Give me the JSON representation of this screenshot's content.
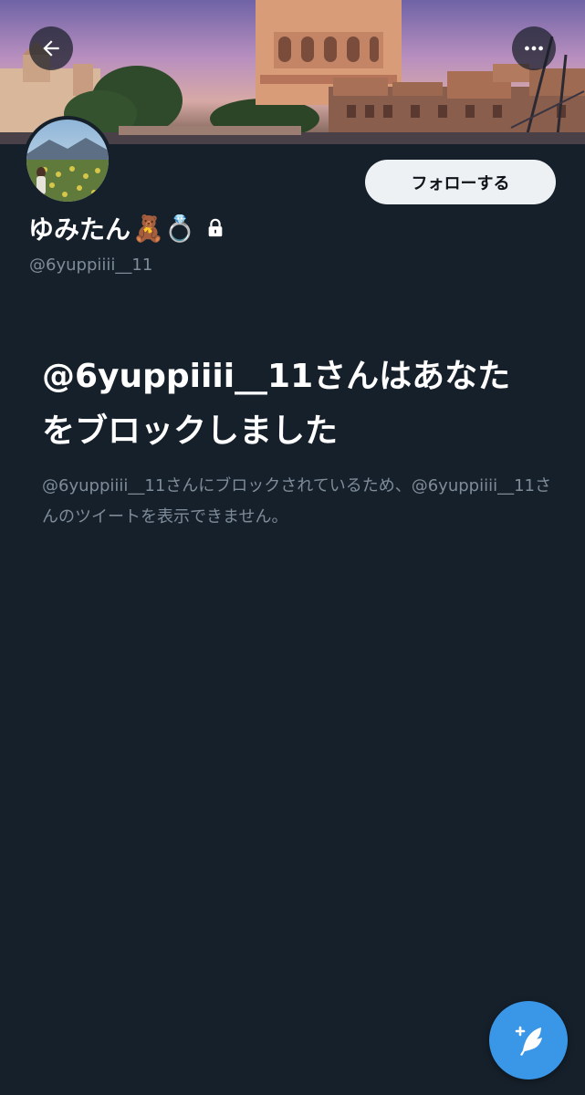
{
  "profile": {
    "display_name": "ゆみたん",
    "name_emojis": "🧸💍",
    "handle": "@6yuppiiii__11",
    "follow_label": "フォローする"
  },
  "blocked": {
    "title": "@6yuppiiii__11さんはあなたをブロックしました",
    "description": "@6yuppiiii__11さんにブロックされているため、@6yuppiiii__11さんのツイートを表示できません。"
  },
  "icons": {
    "back": "arrow-left-icon",
    "more": "more-horizontal-icon",
    "lock": "lock-icon",
    "compose": "compose-tweet-icon"
  },
  "colors": {
    "background": "#16202b",
    "accent": "#3a97e8",
    "secondary_text": "#7e8c99",
    "follow_button_bg": "#eef1f3"
  }
}
